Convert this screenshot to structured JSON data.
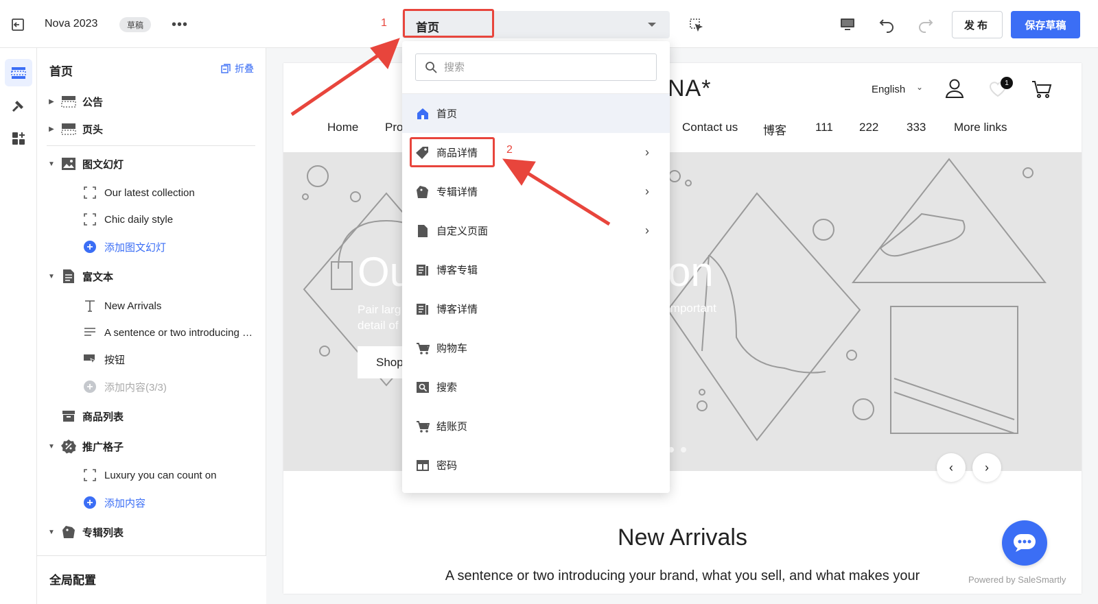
{
  "topbar": {
    "store_name": "Nova 2023",
    "draft_badge": "草稿",
    "more_label": "•••",
    "page_selector_value": "首页",
    "publish_label": "发布",
    "save_draft_label": "保存草稿"
  },
  "annotations": {
    "step1": "1",
    "step2": "2",
    "accent": "#e8453c"
  },
  "sidebar": {
    "title": "首页",
    "collapse_label": "折叠",
    "items": [
      {
        "label": "公告",
        "icon": "announcement-bar-icon"
      },
      {
        "label": "页头",
        "icon": "header-icon"
      },
      {
        "label": "图文幻灯",
        "icon": "image-slideshow-icon"
      },
      {
        "label": "Our latest collection",
        "icon": "block-icon"
      },
      {
        "label": "Chic daily style",
        "icon": "block-icon"
      },
      {
        "label": "添加图文幻灯",
        "icon": "add-circle-icon"
      },
      {
        "label": "富文本",
        "icon": "rich-text-icon"
      },
      {
        "label": "New Arrivals",
        "icon": "text-icon"
      },
      {
        "label": "A sentence or two introducing your brand, what you sell",
        "icon": "paragraph-icon"
      },
      {
        "label": "按钮",
        "icon": "button-icon"
      },
      {
        "label": "添加内容(3/3)",
        "icon": "add-circle-icon"
      },
      {
        "label": "商品列表",
        "icon": "product-list-icon"
      },
      {
        "label": "推广格子",
        "icon": "promotion-icon"
      },
      {
        "label": "Luxury you can count on",
        "icon": "block-icon"
      },
      {
        "label": "添加内容",
        "icon": "add-circle-icon"
      },
      {
        "label": "专辑列表",
        "icon": "collection-list-icon"
      }
    ],
    "footer": "全局配置"
  },
  "dropdown": {
    "search_placeholder": "搜索",
    "items": [
      {
        "label": "首页",
        "icon": "home-icon",
        "selected": true,
        "has_children": false
      },
      {
        "label": "商品详情",
        "icon": "tag-icon",
        "selected": false,
        "has_children": true
      },
      {
        "label": "专辑详情",
        "icon": "collection-icon",
        "selected": false,
        "has_children": true
      },
      {
        "label": "自定义页面",
        "icon": "page-icon",
        "selected": false,
        "has_children": true
      },
      {
        "label": "博客专辑",
        "icon": "blog-icon",
        "selected": false,
        "has_children": false
      },
      {
        "label": "博客详情",
        "icon": "blog-icon",
        "selected": false,
        "has_children": false
      },
      {
        "label": "购物车",
        "icon": "cart-icon",
        "selected": false,
        "has_children": false
      },
      {
        "label": "搜索",
        "icon": "search-page-icon",
        "selected": false,
        "has_children": false
      },
      {
        "label": "结账页",
        "icon": "checkout-icon",
        "selected": false,
        "has_children": false
      },
      {
        "label": "密码",
        "icon": "password-icon",
        "selected": false,
        "has_children": false
      }
    ]
  },
  "preview": {
    "logo": "NA*",
    "language": "English",
    "wishlist_count": "1",
    "nav": [
      "Home",
      "Pro",
      "Contact us",
      "博客",
      "111",
      "222",
      "333",
      "More links"
    ],
    "hero_title_left": "Ou",
    "hero_title_right": "on",
    "hero_sub_line1": "Pair larg",
    "hero_sub_line2": "detail of",
    "hero_sub_right": "important",
    "shop_button": "Shop",
    "section_title": "New Arrivals",
    "section_subtitle": "A sentence or two introducing your brand, what you sell, and what makes your"
  },
  "powered_by": "Powered by SaleSmartly",
  "colors": {
    "primary": "#3b6ef5",
    "annotation_red": "#e8453c"
  }
}
